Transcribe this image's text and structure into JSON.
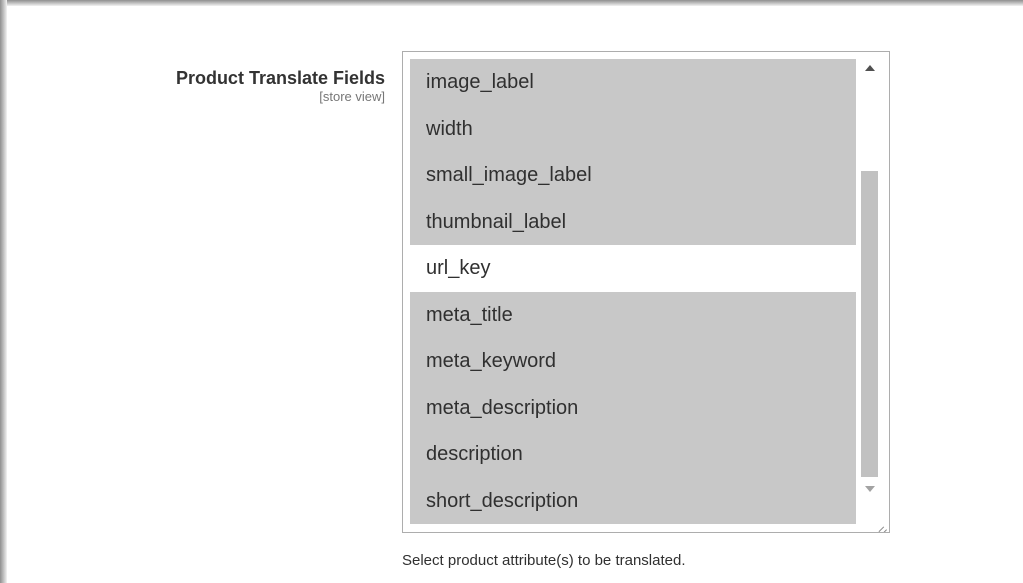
{
  "field": {
    "label": "Product Translate Fields",
    "scope": "[store view]",
    "note": "Select product attribute(s) to be translated."
  },
  "multiselect": {
    "options": [
      {
        "label": "image_label",
        "selected": true
      },
      {
        "label": "width",
        "selected": true
      },
      {
        "label": "small_image_label",
        "selected": true
      },
      {
        "label": "thumbnail_label",
        "selected": true
      },
      {
        "label": "url_key",
        "selected": false
      },
      {
        "label": "meta_title",
        "selected": true
      },
      {
        "label": "meta_keyword",
        "selected": true
      },
      {
        "label": "meta_description",
        "selected": true
      },
      {
        "label": "description",
        "selected": true
      },
      {
        "label": "short_description",
        "selected": true
      }
    ],
    "icons": {
      "scroll_up": "arrow-up-icon",
      "scroll_down": "arrow-down-icon",
      "resize": "resize-grip-icon"
    }
  },
  "colors": {
    "selected_bg": "#c8c8c8",
    "unselected_bg": "#ffffff",
    "text": "#303030",
    "scope_text": "#777777"
  }
}
